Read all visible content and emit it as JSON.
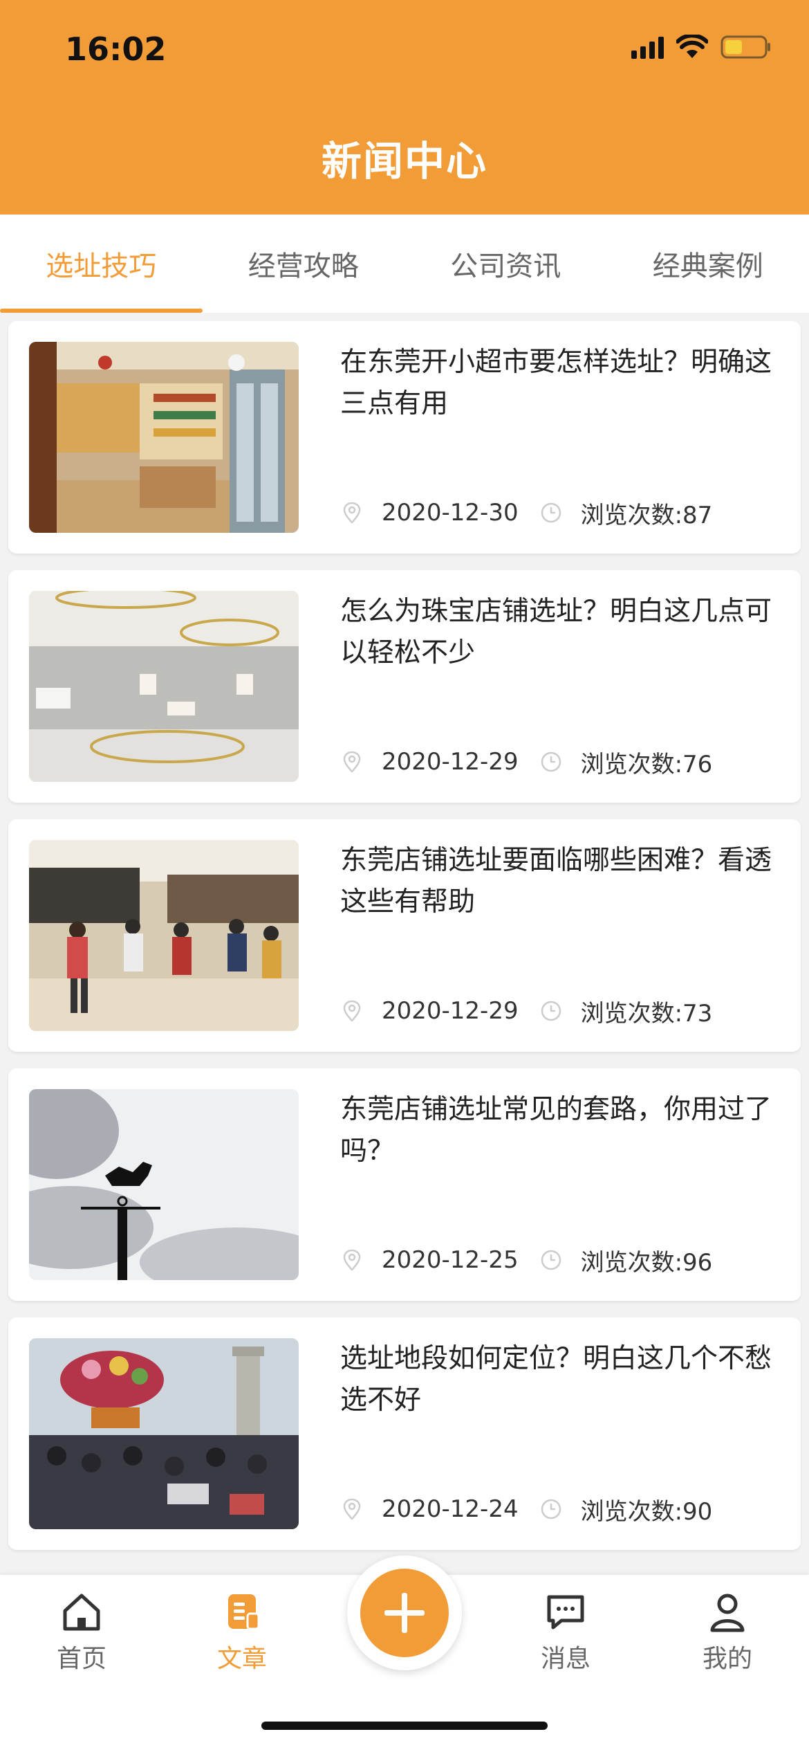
{
  "status": {
    "time": "16:02"
  },
  "header": {
    "title": "新闻中心"
  },
  "colors": {
    "accent": "#f29c37",
    "background": "#f2f2f2"
  },
  "tabs": [
    {
      "label": "选址技巧",
      "active": true
    },
    {
      "label": "经营攻略",
      "active": false
    },
    {
      "label": "公司资讯",
      "active": false
    },
    {
      "label": "经典案例",
      "active": false
    }
  ],
  "articles": [
    {
      "title": "在东莞开小超市要怎样选址？明确这三点有用",
      "date": "2020-12-30",
      "views": "浏览次数:87",
      "image": "supermarket-interior"
    },
    {
      "title": "怎么为珠宝店铺选址？明白这几点可以轻松不少",
      "date": "2020-12-29",
      "views": "浏览次数:76",
      "image": "jewelry-store-interior"
    },
    {
      "title": "东莞店铺选址要面临哪些困难？看透这些有帮助",
      "date": "2020-12-29",
      "views": "浏览次数:73",
      "image": "mall-crowd"
    },
    {
      "title": "东莞店铺选址常见的套路，你用过了吗？",
      "date": "2020-12-25",
      "views": "浏览次数:96",
      "image": "weather-vane-sky"
    },
    {
      "title": "选址地段如何定位？明白这几个不愁选不好",
      "date": "2020-12-24",
      "views": "浏览次数:90",
      "image": "square-crowd-flowers"
    }
  ],
  "icons": {
    "date": "location-pin-icon",
    "views": "clock-icon"
  },
  "bottom_nav": {
    "home": "首页",
    "article": "文章",
    "message": "消息",
    "mine": "我的"
  }
}
